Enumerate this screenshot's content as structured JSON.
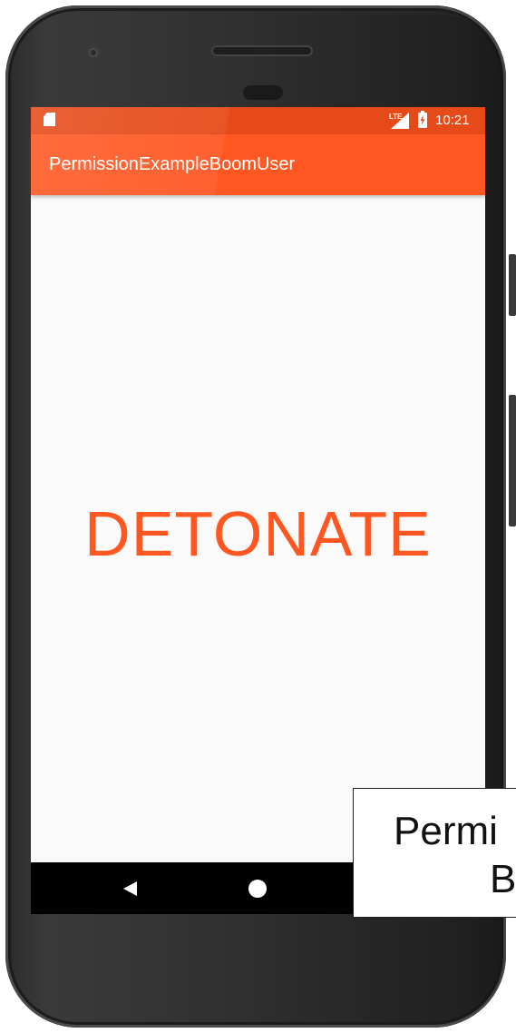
{
  "status_bar": {
    "network": "LTE",
    "time": "10:21",
    "icons": [
      "sd-card-icon",
      "signal-icon",
      "battery-charging-icon"
    ]
  },
  "app_bar": {
    "title": "PermissionExampleBoomUser"
  },
  "main": {
    "detonate_label": "DETONATE",
    "accent_color": "#ff5722"
  },
  "nav_bar": {
    "icons": [
      "back-icon",
      "home-icon"
    ]
  },
  "overlay_caption": {
    "line1": "Permi",
    "line2": "B"
  },
  "colors": {
    "status_bar": "#e64a19",
    "app_bar": "#ff5722",
    "screen_background": "#fafafa",
    "nav_bar": "#000000"
  }
}
